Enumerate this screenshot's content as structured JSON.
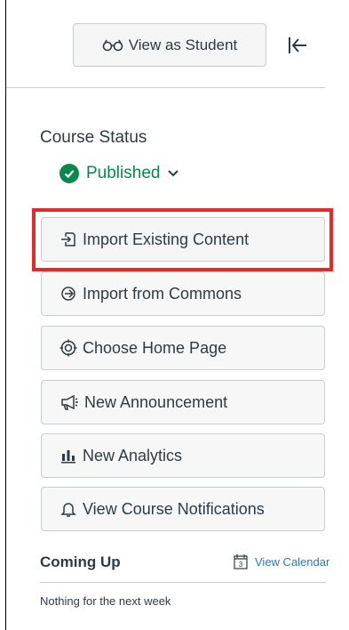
{
  "header": {
    "view_as_student_label": "View as Student",
    "view_as_student_icon": "glasses-icon",
    "collapse_icon": "collapse-left-icon"
  },
  "course_status": {
    "label": "Course Status",
    "state": "Published",
    "state_color": "#0b874b"
  },
  "sidebar_buttons": [
    {
      "label": "Import Existing Content",
      "icon": "import-icon",
      "highlighted": true
    },
    {
      "label": "Import from Commons",
      "icon": "commons-icon"
    },
    {
      "label": "Choose Home Page",
      "icon": "target-icon"
    },
    {
      "label": "New Announcement",
      "icon": "announcement-icon"
    },
    {
      "label": "New Analytics",
      "icon": "analytics-icon"
    },
    {
      "label": "View Course Notifications",
      "icon": "bell-icon"
    }
  ],
  "coming_up": {
    "title": "Coming Up",
    "calendar_label": "View Calendar",
    "calendar_icon_day": "3",
    "empty_text": "Nothing for the next week"
  },
  "colors": {
    "highlight": "#e32b2b",
    "link": "#2b7abc",
    "text": "#2d3b45"
  }
}
